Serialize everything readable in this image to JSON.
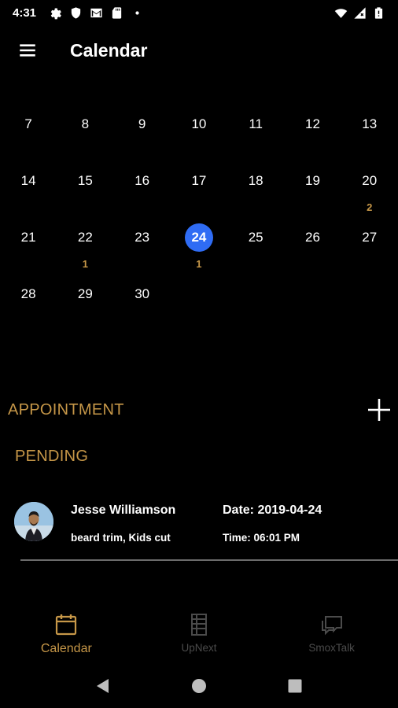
{
  "status_bar": {
    "time": "4:31",
    "left_icons": [
      "gear-icon",
      "shield-icon",
      "gmail-icon",
      "sd-card-icon",
      "dot-icon"
    ],
    "right_icons": [
      "wifi-icon",
      "cell-signal-icon",
      "battery-icon"
    ]
  },
  "app_bar": {
    "title": "Calendar",
    "menu_icon": "hamburger-menu-icon"
  },
  "calendar": {
    "selected_day": "24",
    "accent_color": "#2f6cf4",
    "count_color": "#c69748",
    "weeks": [
      [
        {
          "day": "7",
          "count": ""
        },
        {
          "day": "8",
          "count": ""
        },
        {
          "day": "9",
          "count": ""
        },
        {
          "day": "10",
          "count": ""
        },
        {
          "day": "11",
          "count": ""
        },
        {
          "day": "12",
          "count": ""
        },
        {
          "day": "13",
          "count": ""
        }
      ],
      [
        {
          "day": "14",
          "count": ""
        },
        {
          "day": "15",
          "count": ""
        },
        {
          "day": "16",
          "count": ""
        },
        {
          "day": "17",
          "count": ""
        },
        {
          "day": "18",
          "count": ""
        },
        {
          "day": "19",
          "count": ""
        },
        {
          "day": "20",
          "count": "2"
        }
      ],
      [
        {
          "day": "21",
          "count": ""
        },
        {
          "day": "22",
          "count": "1"
        },
        {
          "day": "23",
          "count": ""
        },
        {
          "day": "24",
          "count": "1"
        },
        {
          "day": "25",
          "count": ""
        },
        {
          "day": "26",
          "count": ""
        },
        {
          "day": "27",
          "count": ""
        }
      ],
      [
        {
          "day": "28",
          "count": ""
        },
        {
          "day": "29",
          "count": ""
        },
        {
          "day": "30",
          "count": ""
        }
      ]
    ]
  },
  "appointment_section": {
    "title": "APPOINTMENT",
    "add_icon": "plus-icon"
  },
  "pending_section": {
    "title": "PENDING",
    "items": [
      {
        "name": "Jesse Williamson",
        "services": "beard trim, Kids cut",
        "date": "Date: 2019-04-24",
        "time": "Time: 06:01 PM"
      }
    ]
  },
  "bottom_nav": {
    "active_color": "#c69748",
    "inactive_color": "#4b4b4b",
    "items": [
      {
        "label": "Calendar",
        "icon": "calendar-icon",
        "active": true
      },
      {
        "label": "UpNext",
        "icon": "film-list-icon",
        "active": false
      },
      {
        "label": "SmoxTalk",
        "icon": "chat-bubbles-icon",
        "active": false
      }
    ]
  },
  "system_nav": {
    "buttons": [
      "back-icon",
      "home-icon",
      "recents-icon"
    ]
  }
}
